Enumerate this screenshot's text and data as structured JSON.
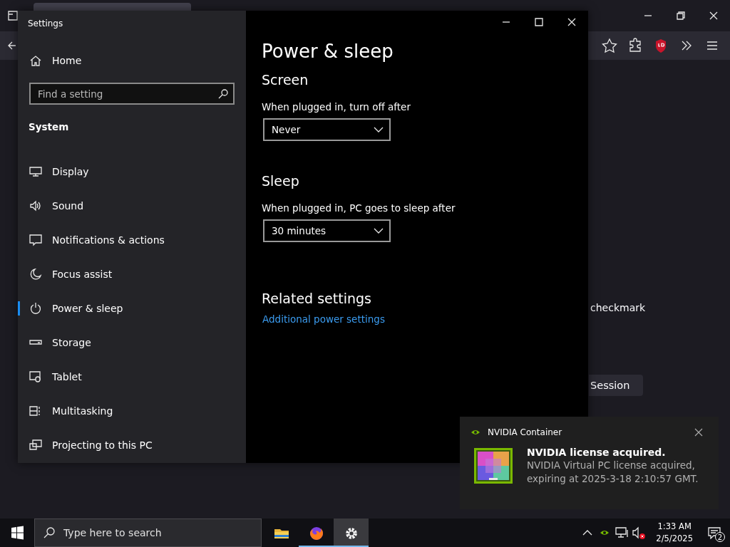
{
  "browser": {
    "content_text": "checkmark",
    "session_button": "Session"
  },
  "settings": {
    "title": "Settings",
    "home": "Home",
    "search": {
      "placeholder": "Find a setting"
    },
    "section": "System",
    "nav_items": [
      {
        "label": "Display",
        "selected": false
      },
      {
        "label": "Sound",
        "selected": false
      },
      {
        "label": "Notifications & actions",
        "selected": false
      },
      {
        "label": "Focus assist",
        "selected": false
      },
      {
        "label": "Power & sleep",
        "selected": true
      },
      {
        "label": "Storage",
        "selected": false
      },
      {
        "label": "Tablet",
        "selected": false
      },
      {
        "label": "Multitasking",
        "selected": false
      },
      {
        "label": "Projecting to this PC",
        "selected": false
      }
    ],
    "page_title": "Power & sleep",
    "groups": [
      {
        "heading": "Screen",
        "label": "When plugged in, turn off after",
        "value": "Never"
      },
      {
        "heading": "Sleep",
        "label": "When plugged in, PC goes to sleep after",
        "value": "30 minutes"
      }
    ],
    "related": {
      "heading": "Related settings",
      "link": "Additional power settings"
    }
  },
  "notification": {
    "app": "NVIDIA Container",
    "title": "NVIDIA license acquired.",
    "body": "NVIDIA Virtual PC license acquired, expiring at 2025-3-18 2:10:57 GMT."
  },
  "taskbar": {
    "search_placeholder": "Type here to search",
    "apps": [
      {
        "running": false,
        "selected": false
      },
      {
        "running": true,
        "selected": false
      },
      {
        "running": true,
        "selected": true
      }
    ],
    "time": "1:33 AM",
    "date": "2/5/2025",
    "notification_count": "2"
  }
}
